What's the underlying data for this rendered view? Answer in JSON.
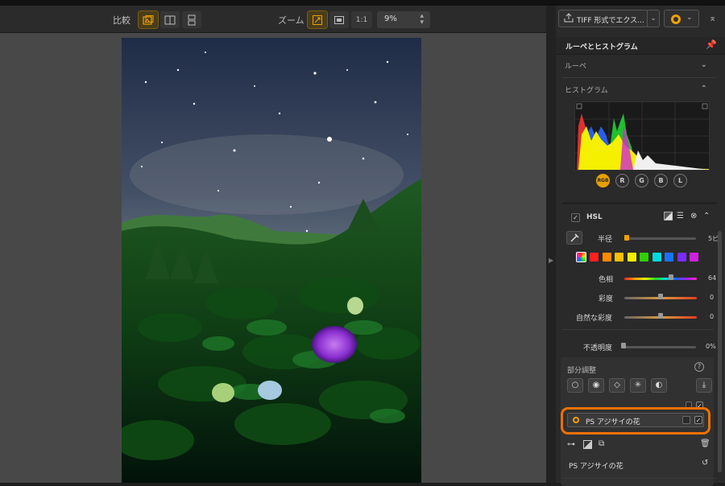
{
  "toolbar": {
    "compare_label": "比較",
    "zoom_label": "ズーム",
    "ratio_label": "1:1",
    "zoom_value": "9%"
  },
  "panel": {
    "export_label": "TIFF 形式でエクス...",
    "section_title": "ルーペとヒストグラム",
    "loupe_label": "ルーペ",
    "histogram_label": "ヒストグラム",
    "channels": [
      "RGB",
      "R",
      "G",
      "B",
      "L"
    ],
    "hsl": {
      "title": "HSL",
      "radius_label": "半径",
      "radius_value": "5ピ",
      "swatch_colors": [
        "#ff2020",
        "#ff8a00",
        "#ffc000",
        "#f2ee00",
        "#2ed000",
        "#00d8e0",
        "#1a72ff",
        "#7a2cff",
        "#d020e0"
      ],
      "hue_label": "色相",
      "hue_value": "64",
      "hue_level": 0.64,
      "saturation_label": "彩度",
      "saturation_value": "0",
      "vibrance_label": "自然な彩度",
      "vibrance_value": "0",
      "opacity_label": "不透明度",
      "opacity_value": "0%"
    },
    "local": {
      "title": "部分調整",
      "help": "?",
      "layer_name": "PS アジサイの花",
      "selected_name": "PS アジサイの花"
    }
  },
  "colors": {
    "accent": "#f0a000",
    "highlight": "#f07000"
  }
}
